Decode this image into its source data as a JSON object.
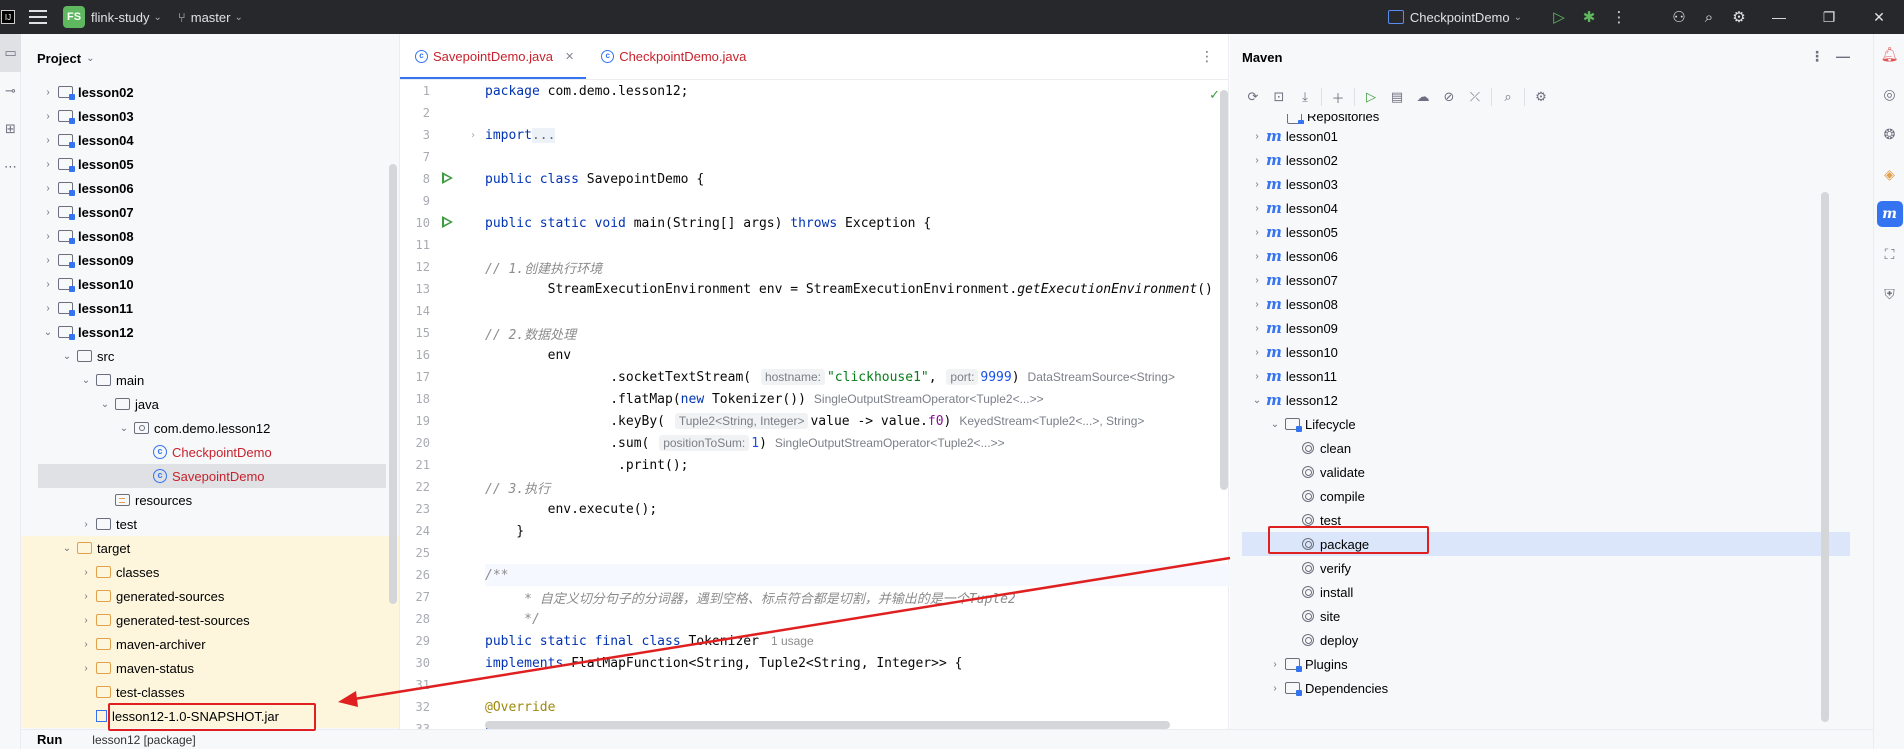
{
  "titlebar": {
    "logo": "IJ",
    "project_badge": "FS",
    "project_name": "flink-study",
    "branch": "master",
    "run_config": "CheckpointDemo"
  },
  "left_strip": {
    "icons": [
      "folder-icon",
      "commit-icon",
      "structure-icon",
      "more-icon"
    ]
  },
  "project": {
    "title": "Project",
    "tree": [
      {
        "label": "lesson02",
        "bold": true,
        "level": 2,
        "arrow": "right",
        "icon": "module"
      },
      {
        "label": "lesson03",
        "bold": true,
        "level": 2,
        "arrow": "right",
        "icon": "module"
      },
      {
        "label": "lesson04",
        "bold": true,
        "level": 2,
        "arrow": "right",
        "icon": "module"
      },
      {
        "label": "lesson05",
        "bold": true,
        "level": 2,
        "arrow": "right",
        "icon": "module"
      },
      {
        "label": "lesson06",
        "bold": true,
        "level": 2,
        "arrow": "right",
        "icon": "module"
      },
      {
        "label": "lesson07",
        "bold": true,
        "level": 2,
        "arrow": "right",
        "icon": "module"
      },
      {
        "label": "lesson08",
        "bold": true,
        "level": 2,
        "arrow": "right",
        "icon": "module"
      },
      {
        "label": "lesson09",
        "bold": true,
        "level": 2,
        "arrow": "right",
        "icon": "module"
      },
      {
        "label": "lesson10",
        "bold": true,
        "level": 2,
        "arrow": "right",
        "icon": "module"
      },
      {
        "label": "lesson11",
        "bold": true,
        "level": 2,
        "arrow": "right",
        "icon": "module"
      },
      {
        "label": "lesson12",
        "bold": true,
        "level": 2,
        "arrow": "down",
        "icon": "module"
      },
      {
        "label": "src",
        "level": 3,
        "arrow": "down",
        "icon": "folder"
      },
      {
        "label": "main",
        "level": 4,
        "arrow": "down",
        "icon": "folder"
      },
      {
        "label": "java",
        "level": 5,
        "arrow": "down",
        "icon": "folder"
      },
      {
        "label": "com.demo.lesson12",
        "level": 6,
        "arrow": "down",
        "icon": "package"
      },
      {
        "label": "CheckpointDemo",
        "level": 7,
        "arrow": "",
        "icon": "class",
        "red": true
      },
      {
        "label": "SavepointDemo",
        "level": 7,
        "arrow": "",
        "icon": "class",
        "red": true,
        "selected": true
      },
      {
        "label": "resources",
        "level": 5,
        "arrow": "",
        "icon": "resources"
      },
      {
        "label": "test",
        "level": 4,
        "arrow": "right",
        "icon": "folder"
      },
      {
        "label": "target",
        "level": 3,
        "arrow": "down",
        "icon": "orange",
        "yellow": true
      },
      {
        "label": "classes",
        "level": 4,
        "arrow": "right",
        "icon": "orange",
        "yellow": true
      },
      {
        "label": "generated-sources",
        "level": 4,
        "arrow": "right",
        "icon": "orange",
        "yellow": true
      },
      {
        "label": "generated-test-sources",
        "level": 4,
        "arrow": "right",
        "icon": "orange",
        "yellow": true
      },
      {
        "label": "maven-archiver",
        "level": 4,
        "arrow": "right",
        "icon": "orange",
        "yellow": true
      },
      {
        "label": "maven-status",
        "level": 4,
        "arrow": "right",
        "icon": "orange",
        "yellow": true
      },
      {
        "label": "test-classes",
        "level": 4,
        "arrow": "",
        "icon": "orange",
        "yellow": true
      },
      {
        "label": "lesson12-1.0-SNAPSHOT.jar",
        "level": 4,
        "arrow": "",
        "icon": "jar",
        "yellow": true
      }
    ]
  },
  "editor": {
    "tabs": [
      {
        "label": "SavepointDemo.java",
        "active": true
      },
      {
        "label": "CheckpointDemo.java",
        "active": false
      }
    ],
    "line_numbers": [
      "1",
      "2",
      "3",
      "7",
      "8",
      "9",
      "10",
      "11",
      "12",
      "13",
      "14",
      "15",
      "16",
      "17",
      "18",
      "19",
      "20",
      "21",
      "22",
      "23",
      "24",
      "25",
      "26",
      "27",
      "28",
      "29",
      "30",
      "31",
      "32",
      "33"
    ],
    "hints": {
      "hostname": "hostname:",
      "host_value": "\"clickhouse1\"",
      "port": "port:",
      "port_value": "9999",
      "datastream": "DataStreamSource<String>",
      "flatmap_type": "SingleOutputStreamOperator<Tuple2<...>>",
      "keyby_param": "Tuple2<String, Integer>",
      "keyed_type": "KeyedStream<Tuple2<...>, String>",
      "sum_param": "positionToSum:",
      "sum_value": "1",
      "sum_type": "SingleOutputStreamOperator<Tuple2<...>>",
      "usage": "1 usage"
    }
  },
  "maven": {
    "title": "Maven",
    "clipped_top": "Repositories",
    "modules": [
      "lesson01",
      "lesson02",
      "lesson03",
      "lesson04",
      "lesson05",
      "lesson06",
      "lesson07",
      "lesson08",
      "lesson09",
      "lesson10",
      "lesson11",
      "lesson12"
    ],
    "lifecycle_label": "Lifecycle",
    "lifecycle": [
      "clean",
      "validate",
      "compile",
      "test",
      "package",
      "verify",
      "install",
      "site",
      "deploy"
    ],
    "selected_phase": "package",
    "plugins_label": "Plugins",
    "dependencies_label": "Dependencies"
  },
  "bottom": {
    "run_label": "Run",
    "run_tab": "lesson12 [package]"
  },
  "colors": {
    "accent": "#3574f0",
    "annotation_red": "#e02020",
    "run_green": "#3d9b3d"
  }
}
